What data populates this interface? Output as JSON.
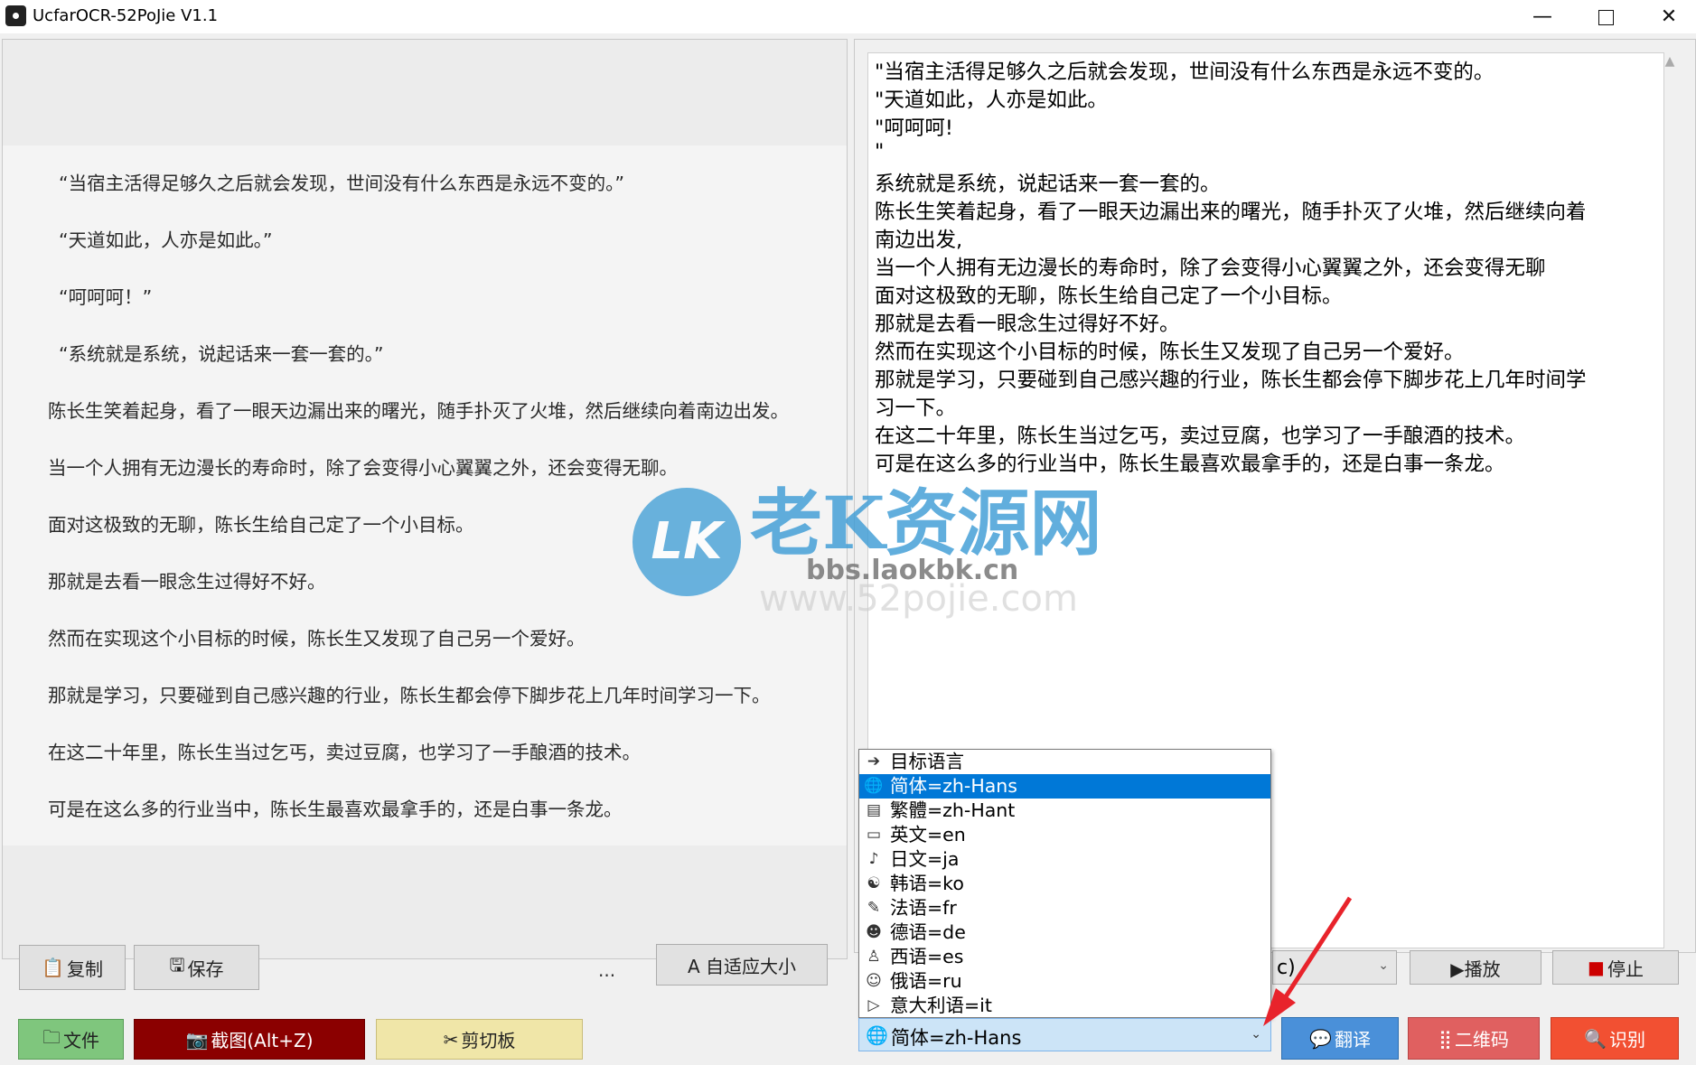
{
  "window": {
    "title": "UcfarOCR-52PoJie V1.1",
    "minimize": "—",
    "close": "✕"
  },
  "source_image": {
    "lines": [
      "“当宿主活得足够久之后就会发现，世间没有什么东西是永远不变的。”",
      "“天道如此，人亦是如此。”",
      "“呵呵呵！”",
      "“系统就是系统，说起话来一套一套的。”",
      "陈长生笑着起身，看了一眼天边漏出来的曙光，随手扑灭了火堆，然后继续向着南边出发。",
      "当一个人拥有无边漫长的寿命时，除了会变得小心翼翼之外，还会变得无聊。",
      "面对这极致的无聊，陈长生给自己定了一个小目标。",
      "那就是去看一眼念生过得好不好。",
      "然而在实现这个小目标的时候，陈长生又发现了自己另一个爱好。",
      "那就是学习，只要碰到自己感兴趣的行业，陈长生都会停下脚步花上几年时间学习一下。",
      "在这二十年里，陈长生当过乞丐，卖过豆腐，也学习了一手酿酒的技术。",
      "可是在这么多的行业当中，陈长生最喜欢最拿手的，还是白事一条龙。"
    ]
  },
  "watermark": {
    "logo_text": "LK",
    "name": "老K资源网",
    "url": "bbs.laokbk.cn",
    "faint": "www.52pojie.com"
  },
  "result": {
    "lines": [
      "\"当宿主活得足够久之后就会发现，世间没有什么东西是永远不变的。",
      "\"天道如此，人亦是如此。",
      "\"呵呵呵!",
      "\"",
      "系统就是系统，说起话来一套一套的。",
      "陈长生笑着起身，看了一眼天边漏出来的曙光，随手扑灭了火堆，然后继续向着",
      "南边出发,",
      "当一个人拥有无边漫长的寿命时，除了会变得小心翼翼之外，还会变得无聊",
      "面对这极致的无聊，陈长生给自己定了一个小目标。",
      "那就是去看一眼念生过得好不好。",
      "然而在实现这个小目标的时候，陈长生又发现了自己另一个爱好。",
      "那就是学习，只要碰到自己感兴趣的行业，陈长生都会停下脚步花上几年时间学",
      "习一下。",
      "在这二十年里，陈长生当过乞丐，卖过豆腐，也学习了一手酿酒的技术。",
      "可是在这么多的行业当中，陈长生最喜欢最拿手的，还是白事一条龙。"
    ]
  },
  "left_toolbar": {
    "copy": "复制",
    "save": "保存",
    "ellipsis": "...",
    "fit": "A 自适应大小"
  },
  "bottom_left": {
    "file": "文件",
    "screenshot": "截图(Alt+Z)",
    "clipboard": "剪切板"
  },
  "tts": {
    "voice_visible": "c)",
    "play": "▶播放",
    "stop": "停止"
  },
  "bottom_right": {
    "translate": "翻译",
    "qrcode": "二维码",
    "recognize": "识别"
  },
  "language": {
    "selected": "简体=zh-Hans",
    "options": [
      {
        "label": "目标语言",
        "icon": "arrow-right-icon",
        "glyph": "➔"
      },
      {
        "label": "简体=zh-Hans",
        "icon": "globe-icon",
        "glyph": "🌐"
      },
      {
        "label": "繁體=zh-Hant",
        "icon": "traditional-chinese-icon",
        "glyph": "▤"
      },
      {
        "label": "英文=en",
        "icon": "abc-icon",
        "glyph": "▭"
      },
      {
        "label": "日文=ja",
        "icon": "japan-icon",
        "glyph": "♪"
      },
      {
        "label": "韩语=ko",
        "icon": "korea-icon",
        "glyph": "☯"
      },
      {
        "label": "法语=fr",
        "icon": "baguette-icon",
        "glyph": "✎"
      },
      {
        "label": "德语=de",
        "icon": "germany-icon",
        "glyph": "☻"
      },
      {
        "label": "西语=es",
        "icon": "spain-icon",
        "glyph": "♙"
      },
      {
        "label": "俄语=ru",
        "icon": "bear-icon",
        "glyph": "☺"
      },
      {
        "label": "意大利语=it",
        "icon": "pizza-icon",
        "glyph": "▷"
      }
    ]
  },
  "colors": {
    "file_button": "#7fc67d",
    "screenshot_button": "#8b0000",
    "clipboard_button": "#f0e6a8",
    "translate_button": "#4a90d9",
    "qrcode_button": "#e06060",
    "recognize_button": "#f25032",
    "selected_item": "#0078d7",
    "annotation_arrow": "#e8232b"
  }
}
